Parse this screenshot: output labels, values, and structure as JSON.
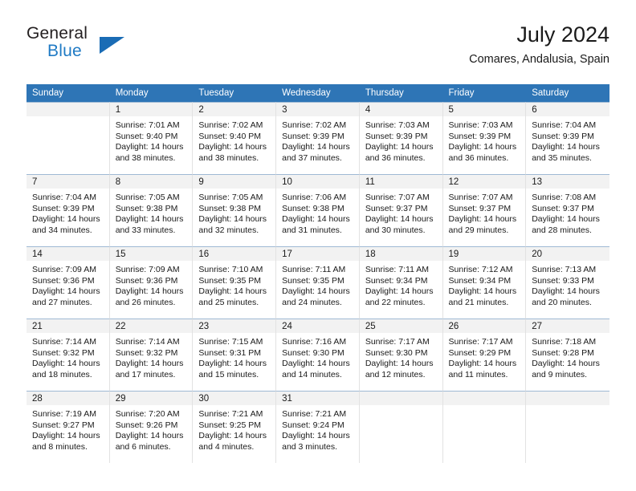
{
  "brand": {
    "line1": "General",
    "line2": "Blue",
    "triangle_color": "#1a6cb5",
    "blue_color": "#1f7ac4"
  },
  "header": {
    "title": "July 2024",
    "location": "Comares, Andalusia, Spain"
  },
  "theme": {
    "header_blue": "#2e75b6",
    "daynum_band": "#f2f2f2",
    "grid_line": "#9fb9d4"
  },
  "weekdays": [
    "Sunday",
    "Monday",
    "Tuesday",
    "Wednesday",
    "Thursday",
    "Friday",
    "Saturday"
  ],
  "labels": {
    "sunrise_prefix": "Sunrise:",
    "sunset_prefix": "Sunset:",
    "daylight_prefix": "Daylight:"
  },
  "weeks": [
    [
      {
        "blank": true
      },
      {
        "day": "1",
        "sunrise": "Sunrise: 7:01 AM",
        "sunset": "Sunset: 9:40 PM",
        "daylight1": "Daylight: 14 hours",
        "daylight2": "and 38 minutes."
      },
      {
        "day": "2",
        "sunrise": "Sunrise: 7:02 AM",
        "sunset": "Sunset: 9:40 PM",
        "daylight1": "Daylight: 14 hours",
        "daylight2": "and 38 minutes."
      },
      {
        "day": "3",
        "sunrise": "Sunrise: 7:02 AM",
        "sunset": "Sunset: 9:39 PM",
        "daylight1": "Daylight: 14 hours",
        "daylight2": "and 37 minutes."
      },
      {
        "day": "4",
        "sunrise": "Sunrise: 7:03 AM",
        "sunset": "Sunset: 9:39 PM",
        "daylight1": "Daylight: 14 hours",
        "daylight2": "and 36 minutes."
      },
      {
        "day": "5",
        "sunrise": "Sunrise: 7:03 AM",
        "sunset": "Sunset: 9:39 PM",
        "daylight1": "Daylight: 14 hours",
        "daylight2": "and 36 minutes."
      },
      {
        "day": "6",
        "sunrise": "Sunrise: 7:04 AM",
        "sunset": "Sunset: 9:39 PM",
        "daylight1": "Daylight: 14 hours",
        "daylight2": "and 35 minutes."
      }
    ],
    [
      {
        "day": "7",
        "sunrise": "Sunrise: 7:04 AM",
        "sunset": "Sunset: 9:39 PM",
        "daylight1": "Daylight: 14 hours",
        "daylight2": "and 34 minutes."
      },
      {
        "day": "8",
        "sunrise": "Sunrise: 7:05 AM",
        "sunset": "Sunset: 9:38 PM",
        "daylight1": "Daylight: 14 hours",
        "daylight2": "and 33 minutes."
      },
      {
        "day": "9",
        "sunrise": "Sunrise: 7:05 AM",
        "sunset": "Sunset: 9:38 PM",
        "daylight1": "Daylight: 14 hours",
        "daylight2": "and 32 minutes."
      },
      {
        "day": "10",
        "sunrise": "Sunrise: 7:06 AM",
        "sunset": "Sunset: 9:38 PM",
        "daylight1": "Daylight: 14 hours",
        "daylight2": "and 31 minutes."
      },
      {
        "day": "11",
        "sunrise": "Sunrise: 7:07 AM",
        "sunset": "Sunset: 9:37 PM",
        "daylight1": "Daylight: 14 hours",
        "daylight2": "and 30 minutes."
      },
      {
        "day": "12",
        "sunrise": "Sunrise: 7:07 AM",
        "sunset": "Sunset: 9:37 PM",
        "daylight1": "Daylight: 14 hours",
        "daylight2": "and 29 minutes."
      },
      {
        "day": "13",
        "sunrise": "Sunrise: 7:08 AM",
        "sunset": "Sunset: 9:37 PM",
        "daylight1": "Daylight: 14 hours",
        "daylight2": "and 28 minutes."
      }
    ],
    [
      {
        "day": "14",
        "sunrise": "Sunrise: 7:09 AM",
        "sunset": "Sunset: 9:36 PM",
        "daylight1": "Daylight: 14 hours",
        "daylight2": "and 27 minutes."
      },
      {
        "day": "15",
        "sunrise": "Sunrise: 7:09 AM",
        "sunset": "Sunset: 9:36 PM",
        "daylight1": "Daylight: 14 hours",
        "daylight2": "and 26 minutes."
      },
      {
        "day": "16",
        "sunrise": "Sunrise: 7:10 AM",
        "sunset": "Sunset: 9:35 PM",
        "daylight1": "Daylight: 14 hours",
        "daylight2": "and 25 minutes."
      },
      {
        "day": "17",
        "sunrise": "Sunrise: 7:11 AM",
        "sunset": "Sunset: 9:35 PM",
        "daylight1": "Daylight: 14 hours",
        "daylight2": "and 24 minutes."
      },
      {
        "day": "18",
        "sunrise": "Sunrise: 7:11 AM",
        "sunset": "Sunset: 9:34 PM",
        "daylight1": "Daylight: 14 hours",
        "daylight2": "and 22 minutes."
      },
      {
        "day": "19",
        "sunrise": "Sunrise: 7:12 AM",
        "sunset": "Sunset: 9:34 PM",
        "daylight1": "Daylight: 14 hours",
        "daylight2": "and 21 minutes."
      },
      {
        "day": "20",
        "sunrise": "Sunrise: 7:13 AM",
        "sunset": "Sunset: 9:33 PM",
        "daylight1": "Daylight: 14 hours",
        "daylight2": "and 20 minutes."
      }
    ],
    [
      {
        "day": "21",
        "sunrise": "Sunrise: 7:14 AM",
        "sunset": "Sunset: 9:32 PM",
        "daylight1": "Daylight: 14 hours",
        "daylight2": "and 18 minutes."
      },
      {
        "day": "22",
        "sunrise": "Sunrise: 7:14 AM",
        "sunset": "Sunset: 9:32 PM",
        "daylight1": "Daylight: 14 hours",
        "daylight2": "and 17 minutes."
      },
      {
        "day": "23",
        "sunrise": "Sunrise: 7:15 AM",
        "sunset": "Sunset: 9:31 PM",
        "daylight1": "Daylight: 14 hours",
        "daylight2": "and 15 minutes."
      },
      {
        "day": "24",
        "sunrise": "Sunrise: 7:16 AM",
        "sunset": "Sunset: 9:30 PM",
        "daylight1": "Daylight: 14 hours",
        "daylight2": "and 14 minutes."
      },
      {
        "day": "25",
        "sunrise": "Sunrise: 7:17 AM",
        "sunset": "Sunset: 9:30 PM",
        "daylight1": "Daylight: 14 hours",
        "daylight2": "and 12 minutes."
      },
      {
        "day": "26",
        "sunrise": "Sunrise: 7:17 AM",
        "sunset": "Sunset: 9:29 PM",
        "daylight1": "Daylight: 14 hours",
        "daylight2": "and 11 minutes."
      },
      {
        "day": "27",
        "sunrise": "Sunrise: 7:18 AM",
        "sunset": "Sunset: 9:28 PM",
        "daylight1": "Daylight: 14 hours",
        "daylight2": "and 9 minutes."
      }
    ],
    [
      {
        "day": "28",
        "sunrise": "Sunrise: 7:19 AM",
        "sunset": "Sunset: 9:27 PM",
        "daylight1": "Daylight: 14 hours",
        "daylight2": "and 8 minutes."
      },
      {
        "day": "29",
        "sunrise": "Sunrise: 7:20 AM",
        "sunset": "Sunset: 9:26 PM",
        "daylight1": "Daylight: 14 hours",
        "daylight2": "and 6 minutes."
      },
      {
        "day": "30",
        "sunrise": "Sunrise: 7:21 AM",
        "sunset": "Sunset: 9:25 PM",
        "daylight1": "Daylight: 14 hours",
        "daylight2": "and 4 minutes."
      },
      {
        "day": "31",
        "sunrise": "Sunrise: 7:21 AM",
        "sunset": "Sunset: 9:24 PM",
        "daylight1": "Daylight: 14 hours",
        "daylight2": "and 3 minutes."
      },
      {
        "blank": true
      },
      {
        "blank": true
      },
      {
        "blank": true
      }
    ]
  ]
}
